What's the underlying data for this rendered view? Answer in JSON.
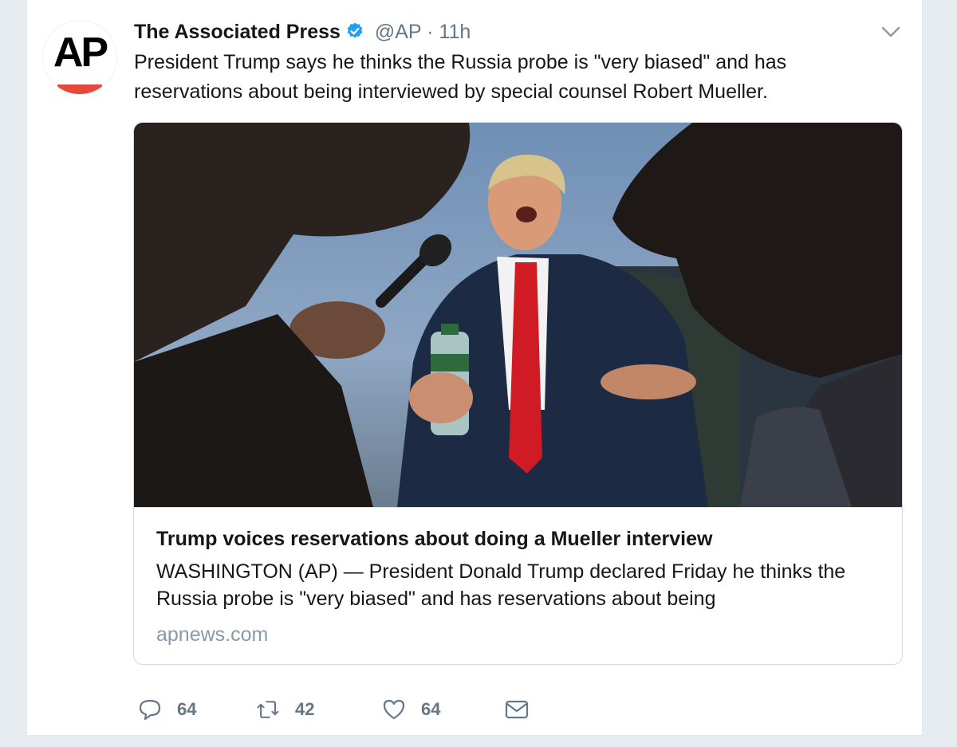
{
  "tweet": {
    "author_name": "The Associated Press",
    "handle": "@AP",
    "separator": "·",
    "time": "11h",
    "avatar_text": "AP",
    "text": "President Trump says he thinks the Russia probe is \"very biased\" and has reservations about being interviewed by special counsel Robert Mueller."
  },
  "card": {
    "image_alt": "",
    "title": "Trump voices reservations about doing a Mueller interview",
    "description": "WASHINGTON (AP) — President Donald Trump declared Friday he thinks the Russia probe is \"very biased\" and has reservations about being",
    "domain": "apnews.com"
  },
  "actions": {
    "reply_count": "64",
    "retweet_count": "42",
    "like_count": "64"
  },
  "icons": {
    "verified": "verified-badge-icon",
    "chevron": "chevron-down-icon",
    "reply": "reply-icon",
    "retweet": "retweet-icon",
    "like": "heart-icon",
    "dm": "envelope-icon"
  },
  "colors": {
    "verified_blue": "#1da1f2",
    "ap_red": "#e8483a",
    "muted_text": "#657786",
    "tie_red": "#d01a24"
  }
}
